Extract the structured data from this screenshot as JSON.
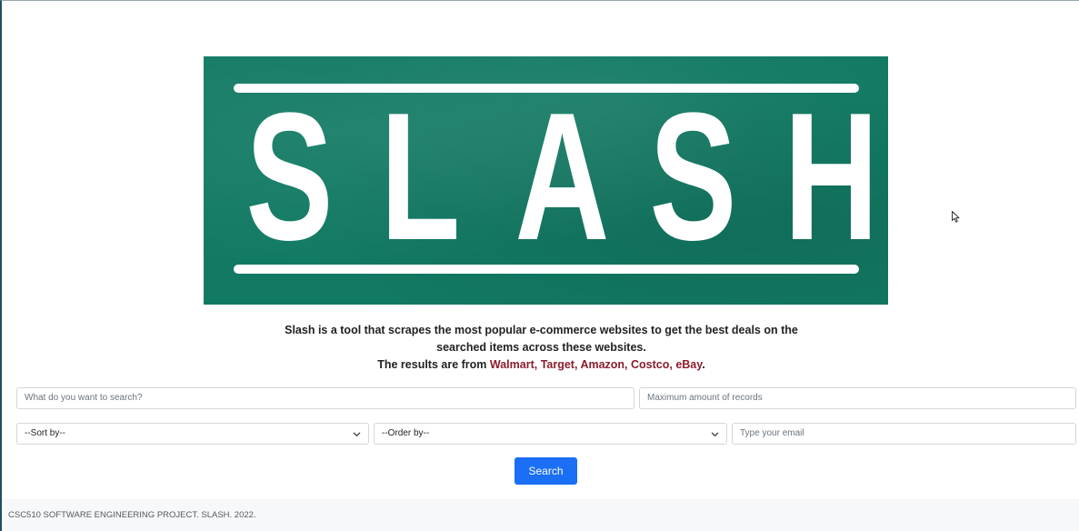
{
  "logo": {
    "text": "SLASH",
    "letters": [
      "S",
      "L",
      "A",
      "S",
      "H"
    ],
    "bg_color": "#127a63"
  },
  "description": {
    "line1": "Slash is a tool that scrapes the most popular e-commerce websites to get the best deals on the",
    "line2": "searched items across these websites.",
    "line3_prefix": "The results are from ",
    "sites": "Walmart, Target, Amazon, Costco, eBay",
    "line3_suffix": ".",
    "sites_color": "#8b1e2c"
  },
  "form": {
    "search_placeholder": "What do you want to search?",
    "max_records_placeholder": "Maximum amount of records",
    "sort_by": "--Sort by--",
    "order_by": "--Order by--",
    "email_placeholder": "Type your email",
    "search_button": "Search",
    "button_color": "#1a6ff5"
  },
  "footer": {
    "text": "CSC510 SOFTWARE ENGINEERING PROJECT. SLASH. 2022."
  }
}
